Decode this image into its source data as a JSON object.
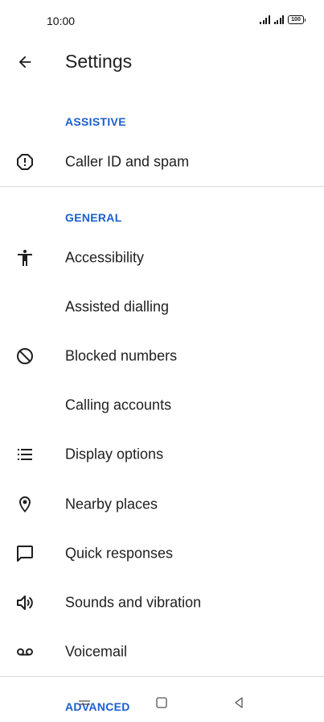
{
  "status_bar": {
    "time": "10:00",
    "battery": "100"
  },
  "app_bar": {
    "title": "Settings",
    "back_icon": "arrow-back-icon"
  },
  "sections": {
    "assistive": "ASSISTIVE",
    "general": "GENERAL",
    "advanced": "ADVANCED"
  },
  "assistive_items": [
    {
      "label": "Caller ID and spam",
      "icon": "alert-circle-icon"
    }
  ],
  "general_items": [
    {
      "label": "Accessibility",
      "icon": "accessibility-icon"
    },
    {
      "label": "Assisted dialling",
      "icon": ""
    },
    {
      "label": "Blocked numbers",
      "icon": "block-icon"
    },
    {
      "label": "Calling accounts",
      "icon": ""
    },
    {
      "label": "Display options",
      "icon": "list-icon"
    },
    {
      "label": "Nearby places",
      "icon": "location-pin-icon"
    },
    {
      "label": "Quick responses",
      "icon": "message-icon"
    },
    {
      "label": "Sounds and vibration",
      "icon": "volume-icon"
    },
    {
      "label": "Voicemail",
      "icon": "voicemail-icon"
    }
  ],
  "colors": {
    "accent": "#1a5fcf",
    "text": "#1f1f1f",
    "divider": "#dadada"
  }
}
